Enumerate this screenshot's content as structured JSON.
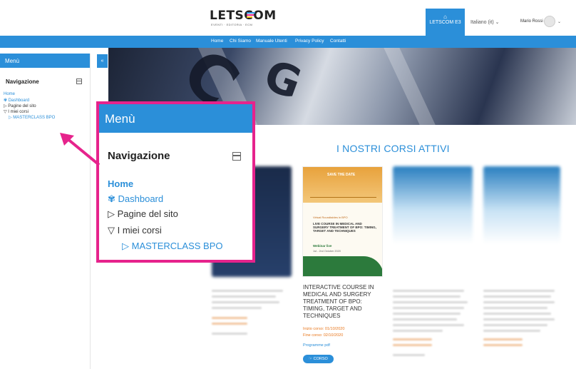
{
  "header": {
    "logo_text": "LETSCOM",
    "logo_sub": "EVENTI · EDITORIA · ECM",
    "brand_button": "LETSCOM E3",
    "language": "Italiano (it) ⌄",
    "user_name": "Mario Rossi",
    "user_caret": "⌄"
  },
  "nav": [
    "Home",
    "Chi Siamo",
    "Manuale Utenti",
    "Privacy Policy",
    "Contatti"
  ],
  "drawer": {
    "title": "Menù",
    "nav_title": "Navigazione",
    "items": {
      "home": "Home",
      "dashboard": "Dashboard",
      "pagine": "Pagine del sito",
      "miei_corsi": "I miei corsi",
      "masterclass": "MASTERCLASS BPO"
    }
  },
  "section_title": "I NOSTRI CORSI ATTIVI",
  "course": {
    "poster_save": "SAVE THE DATE",
    "poster_kicker": "Virtual Roundtables in BPO",
    "poster_title": "LIVE COURSE IN MEDICAL AND SURGERY TREATMENT OF BPO: TIMING, TARGET AND TECHNIQUES",
    "poster_webinar": "Webinar live",
    "poster_dates": "1st - 2nd October 2020",
    "title": "INTERACTIVE COURSE IN MEDICAL AND SURGERY TREATMENT OF BPO: TIMING, TARGET AND TECHNIQUES",
    "start": "Inizio corso: 01/10/2020",
    "end": "Fine corso: 02/10/2020",
    "pdf": "Programme pdf",
    "button": "CORSO"
  },
  "colors": {
    "accent": "#2b8fd9",
    "highlight": "#e6238c",
    "date": "#e8761c"
  }
}
